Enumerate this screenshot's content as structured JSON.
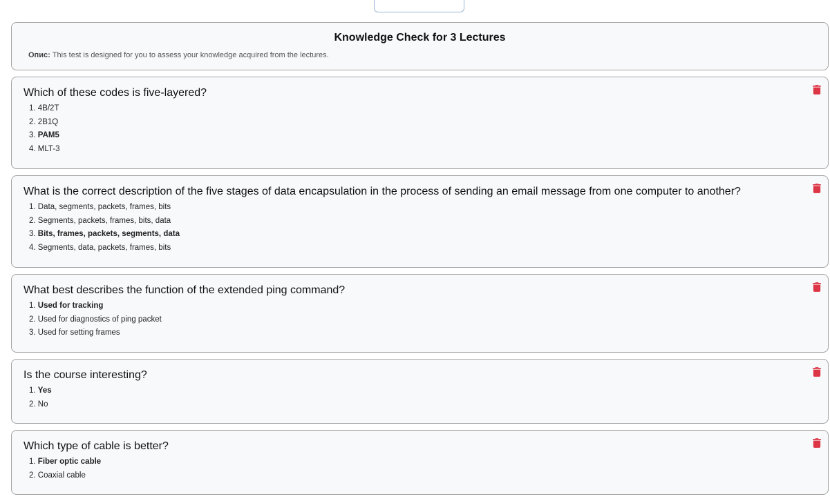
{
  "header": {
    "title": "Knowledge Check for 3 Lectures",
    "desc_label": "Опис:",
    "desc_text": " This test is designed for you to assess your knowledge acquired from the lectures."
  },
  "colors": {
    "trash": "#dc3545",
    "card_bg": "#f8f9fb",
    "card_border": "#a3a3a3"
  },
  "questions": [
    {
      "text": "Which of these codes is five-layered?",
      "options": [
        {
          "num": "1.",
          "text": "4B/2T",
          "correct": false
        },
        {
          "num": "2.",
          "text": "2B1Q",
          "correct": false
        },
        {
          "num": "3.",
          "text": "PAM5",
          "correct": true
        },
        {
          "num": "4.",
          "text": "MLT-3",
          "correct": false
        }
      ],
      "delete_icon": "trash-icon"
    },
    {
      "text": "What is the correct description of the five stages of data encapsulation in the process of sending an email message from one computer to another?",
      "options": [
        {
          "num": "1.",
          "text": "Data, segments, packets, frames, bits",
          "correct": false
        },
        {
          "num": "2.",
          "text": "Segments, packets, frames, bits, data",
          "correct": false
        },
        {
          "num": "3.",
          "text": "Bits, frames, packets, segments, data",
          "correct": true
        },
        {
          "num": "4.",
          "text": "Segments, data, packets, frames, bits",
          "correct": false
        }
      ],
      "delete_icon": "trash-icon"
    },
    {
      "text": "What best describes the function of the extended ping command?",
      "options": [
        {
          "num": "1.",
          "text": "Used for tracking",
          "correct": true
        },
        {
          "num": "2.",
          "text": "Used for diagnostics of ping packet",
          "correct": false
        },
        {
          "num": "3.",
          "text": "Used for setting frames",
          "correct": false
        }
      ],
      "delete_icon": "trash-icon"
    },
    {
      "text": "Is the course interesting?",
      "options": [
        {
          "num": "1.",
          "text": "Yes",
          "correct": true
        },
        {
          "num": "2.",
          "text": "No",
          "correct": false
        }
      ],
      "delete_icon": "trash-icon"
    },
    {
      "text": "Which type of cable is better?",
      "options": [
        {
          "num": "1.",
          "text": "Fiber optic cable",
          "correct": true
        },
        {
          "num": "2.",
          "text": "Coaxial cable",
          "correct": false
        }
      ],
      "delete_icon": "trash-icon"
    }
  ]
}
